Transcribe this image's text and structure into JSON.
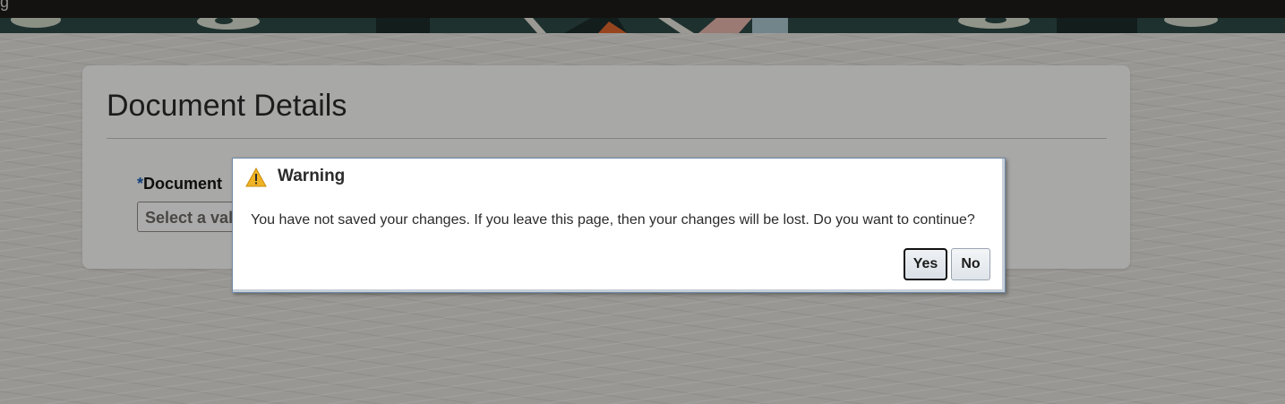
{
  "topbar": {
    "glyph": "g"
  },
  "card": {
    "title": "Document Details",
    "field": {
      "required_mark": "*",
      "label": "Document",
      "placeholder": "Select a val"
    }
  },
  "dialog": {
    "icon": "warning-icon",
    "title": "Warning",
    "message": "You have not saved your changes. If you leave this page, then your changes will be lost. Do you want to continue?",
    "yes_label": "Yes",
    "no_label": "No"
  },
  "colors": {
    "accent": "#1a5fb4",
    "warning": "#f0b323",
    "overlay": "rgba(0,0,0,0.33)"
  }
}
